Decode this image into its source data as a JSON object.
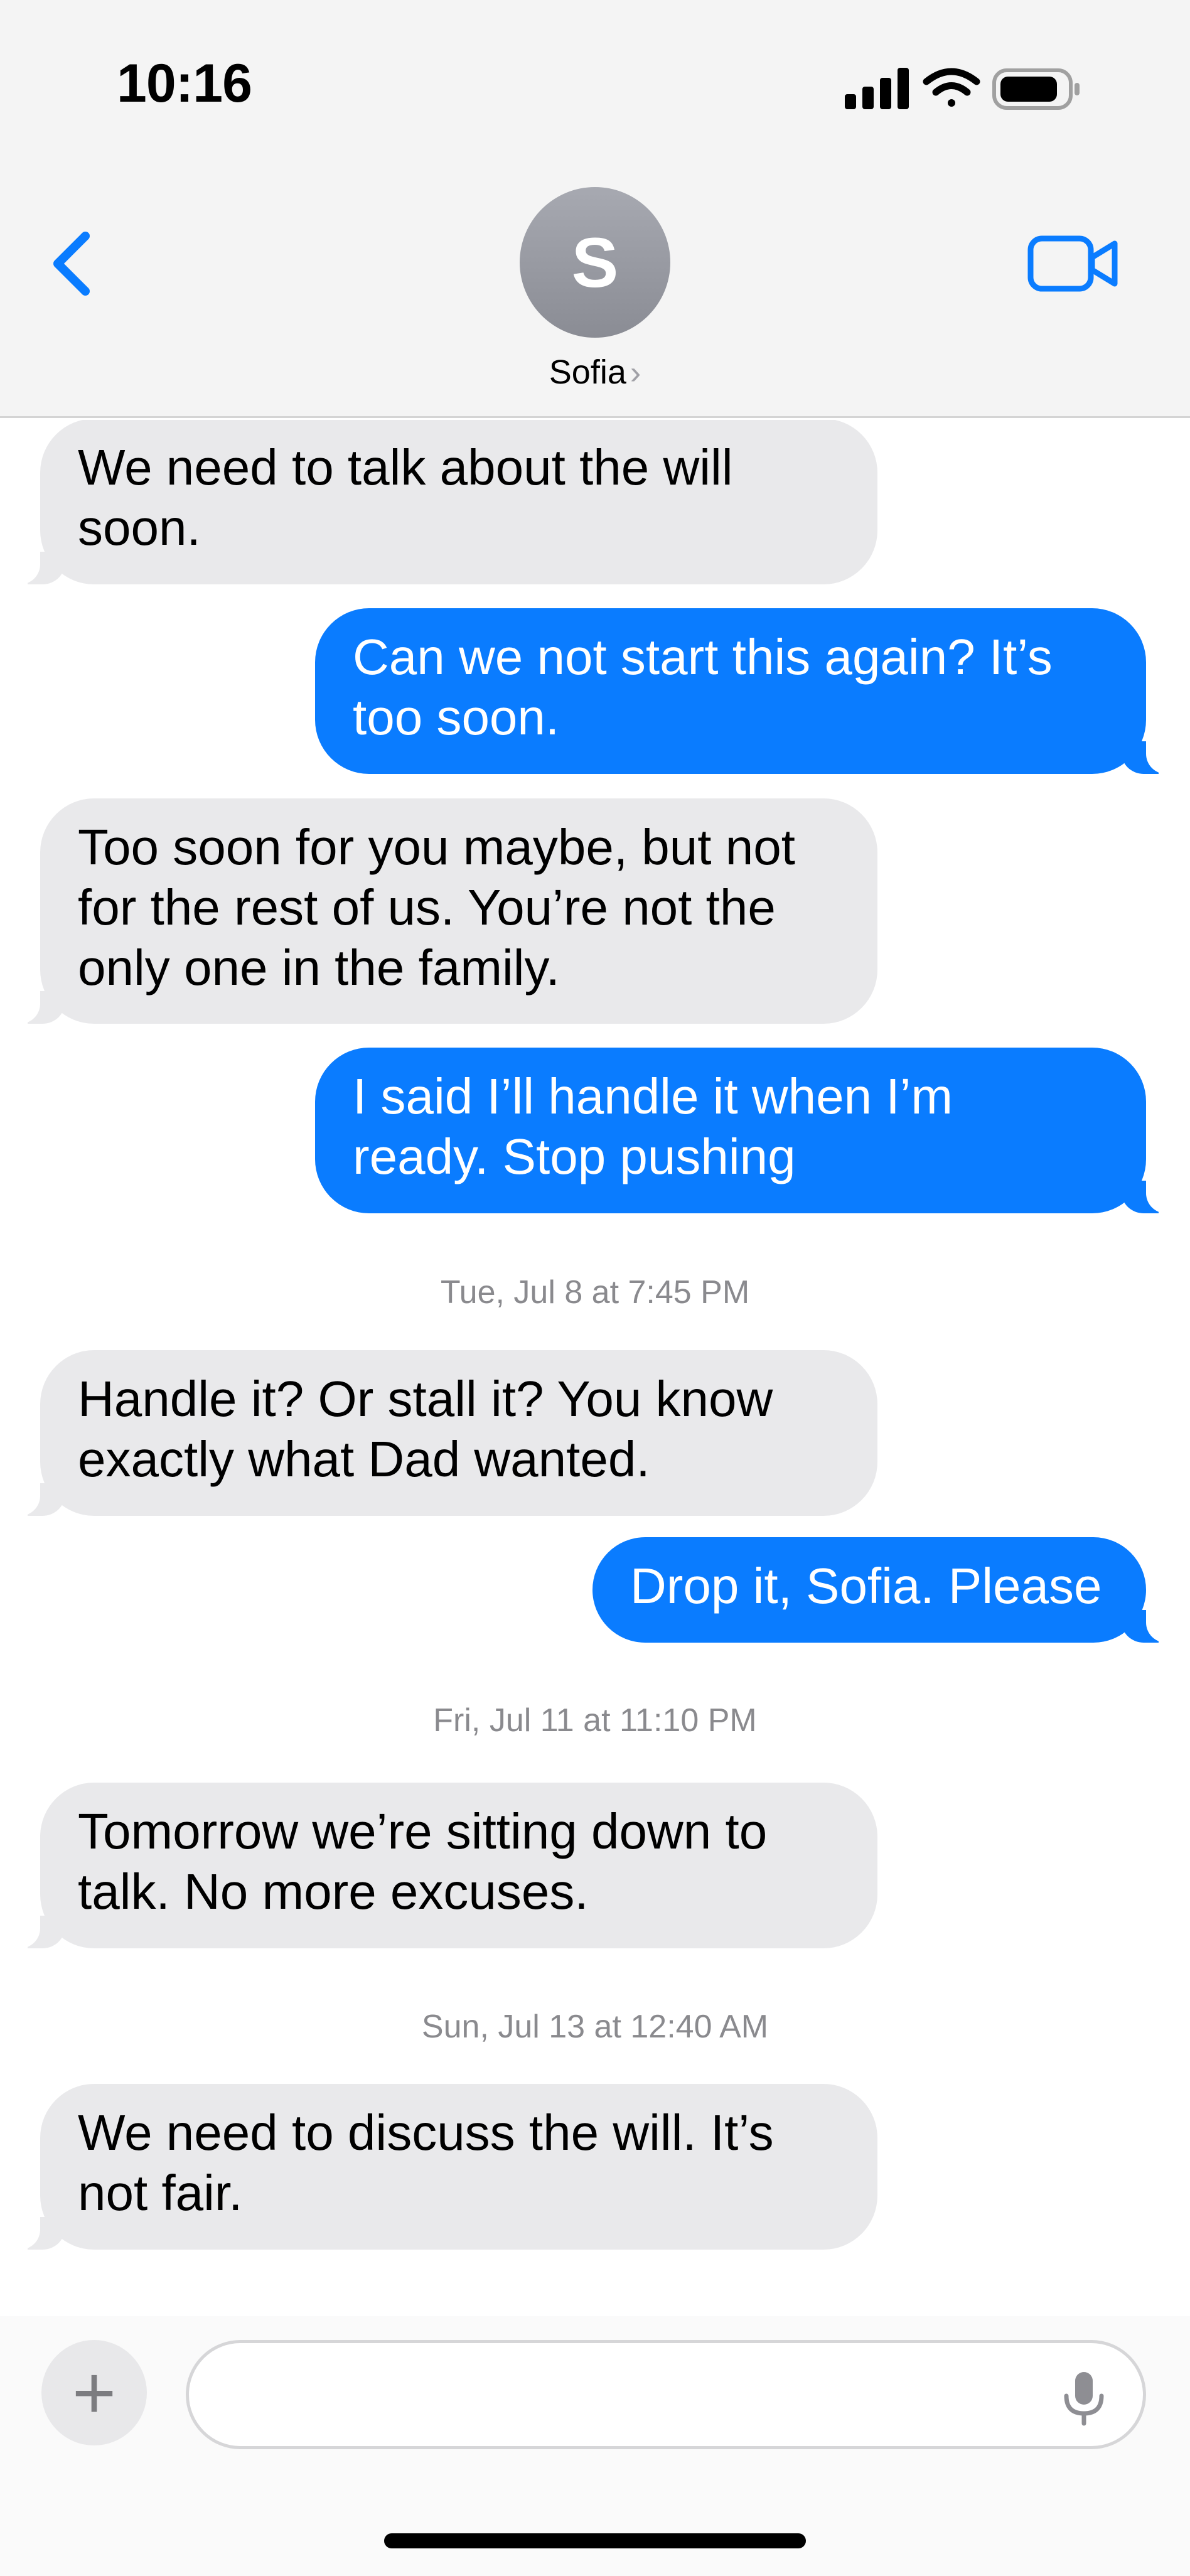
{
  "status_bar": {
    "time": "10:16",
    "icons": [
      "cellular-signal-icon",
      "wifi-icon",
      "battery-icon"
    ]
  },
  "header": {
    "back_icon": "chevron-left-icon",
    "avatar_initial": "S",
    "contact_name": "Sofia",
    "contact_chevron": "›",
    "video_call_icon": "video-camera-icon",
    "accent_color": "#0a7cff"
  },
  "messages": [
    {
      "direction": "incoming",
      "text": "We need to talk about the will\nsoon."
    },
    {
      "direction": "outgoing",
      "text": "Can we not start this again? It’s\ntoo soon."
    },
    {
      "direction": "incoming",
      "text": "Too soon for you maybe, but not\nfor the rest of us. You’re not the\nonly one in the family."
    },
    {
      "direction": "outgoing",
      "text": "I said I’ll handle it when I’m\nready. Stop pushing"
    },
    {
      "timestamp": "Tue, Jul 8 at 7:45 PM"
    },
    {
      "direction": "incoming",
      "text": "Handle it? Or stall it? You know\nexactly what Dad wanted."
    },
    {
      "direction": "outgoing",
      "text": "Drop it, Sofia. Please"
    },
    {
      "timestamp": "Fri, Jul 11 at 11:10 PM"
    },
    {
      "direction": "incoming",
      "text": "Tomorrow we’re sitting down to\ntalk. No more excuses."
    },
    {
      "timestamp": "Sun, Jul 13 at 12:40 AM"
    },
    {
      "direction": "incoming",
      "text": "We need to discuss the will. It’s\nnot fair."
    }
  ],
  "composer": {
    "plus_label": "+",
    "input_value": "",
    "input_placeholder": "",
    "mic_icon": "microphone-icon"
  },
  "colors": {
    "incoming_bubble": "#e9e9eb",
    "outgoing_bubble": "#0a7cff",
    "timestamp_text": "#8a8a8e"
  }
}
